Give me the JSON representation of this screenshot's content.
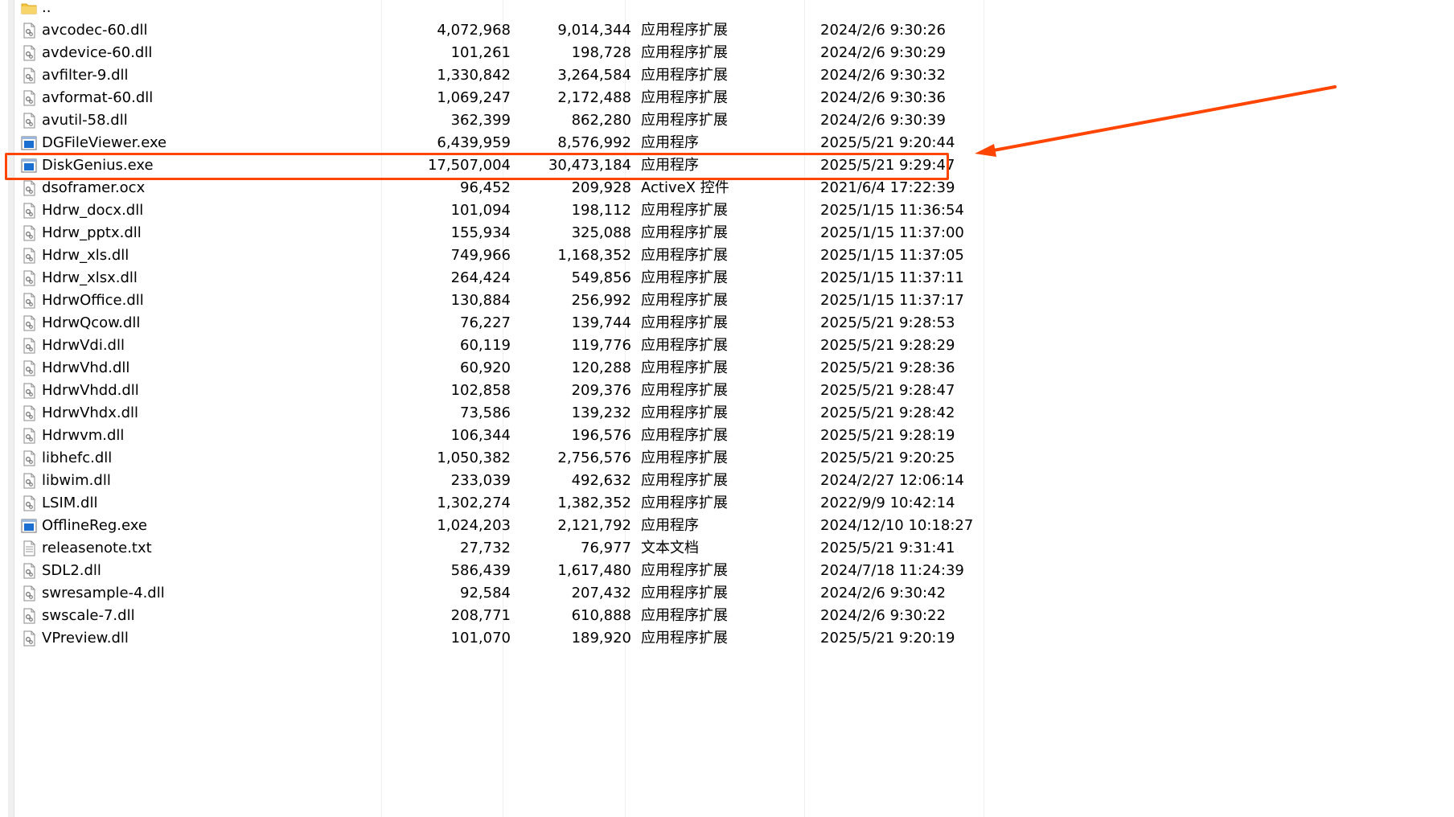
{
  "files": [
    {
      "icon": "folder-up-icon",
      "name": "..",
      "size": "",
      "packed": "",
      "type": "",
      "modified": ""
    },
    {
      "icon": "dll-file-icon",
      "name": "avcodec-60.dll",
      "size": "4,072,968",
      "packed": "9,014,344",
      "type": "应用程序扩展",
      "modified": "2024/2/6 9:30:26"
    },
    {
      "icon": "dll-file-icon",
      "name": "avdevice-60.dll",
      "size": "101,261",
      "packed": "198,728",
      "type": "应用程序扩展",
      "modified": "2024/2/6 9:30:29"
    },
    {
      "icon": "dll-file-icon",
      "name": "avfilter-9.dll",
      "size": "1,330,842",
      "packed": "3,264,584",
      "type": "应用程序扩展",
      "modified": "2024/2/6 9:30:32"
    },
    {
      "icon": "dll-file-icon",
      "name": "avformat-60.dll",
      "size": "1,069,247",
      "packed": "2,172,488",
      "type": "应用程序扩展",
      "modified": "2024/2/6 9:30:36"
    },
    {
      "icon": "dll-file-icon",
      "name": "avutil-58.dll",
      "size": "362,399",
      "packed": "862,280",
      "type": "应用程序扩展",
      "modified": "2024/2/6 9:30:39"
    },
    {
      "icon": "exe-file-icon",
      "name": "DGFileViewer.exe",
      "size": "6,439,959",
      "packed": "8,576,992",
      "type": "应用程序",
      "modified": "2025/5/21 9:20:44"
    },
    {
      "icon": "exe-file-icon",
      "name": "DiskGenius.exe",
      "size": "17,507,004",
      "packed": "30,473,184",
      "type": "应用程序",
      "modified": "2025/5/21 9:29:47"
    },
    {
      "icon": "dll-file-icon",
      "name": "dsoframer.ocx",
      "size": "96,452",
      "packed": "209,928",
      "type": "ActiveX 控件",
      "modified": "2021/6/4 17:22:39"
    },
    {
      "icon": "dll-file-icon",
      "name": "Hdrw_docx.dll",
      "size": "101,094",
      "packed": "198,112",
      "type": "应用程序扩展",
      "modified": "2025/1/15 11:36:54"
    },
    {
      "icon": "dll-file-icon",
      "name": "Hdrw_pptx.dll",
      "size": "155,934",
      "packed": "325,088",
      "type": "应用程序扩展",
      "modified": "2025/1/15 11:37:00"
    },
    {
      "icon": "dll-file-icon",
      "name": "Hdrw_xls.dll",
      "size": "749,966",
      "packed": "1,168,352",
      "type": "应用程序扩展",
      "modified": "2025/1/15 11:37:05"
    },
    {
      "icon": "dll-file-icon",
      "name": "Hdrw_xlsx.dll",
      "size": "264,424",
      "packed": "549,856",
      "type": "应用程序扩展",
      "modified": "2025/1/15 11:37:11"
    },
    {
      "icon": "dll-file-icon",
      "name": "HdrwOffice.dll",
      "size": "130,884",
      "packed": "256,992",
      "type": "应用程序扩展",
      "modified": "2025/1/15 11:37:17"
    },
    {
      "icon": "dll-file-icon",
      "name": "HdrwQcow.dll",
      "size": "76,227",
      "packed": "139,744",
      "type": "应用程序扩展",
      "modified": "2025/5/21 9:28:53"
    },
    {
      "icon": "dll-file-icon",
      "name": "HdrwVdi.dll",
      "size": "60,119",
      "packed": "119,776",
      "type": "应用程序扩展",
      "modified": "2025/5/21 9:28:29"
    },
    {
      "icon": "dll-file-icon",
      "name": "HdrwVhd.dll",
      "size": "60,920",
      "packed": "120,288",
      "type": "应用程序扩展",
      "modified": "2025/5/21 9:28:36"
    },
    {
      "icon": "dll-file-icon",
      "name": "HdrwVhdd.dll",
      "size": "102,858",
      "packed": "209,376",
      "type": "应用程序扩展",
      "modified": "2025/5/21 9:28:47"
    },
    {
      "icon": "dll-file-icon",
      "name": "HdrwVhdx.dll",
      "size": "73,586",
      "packed": "139,232",
      "type": "应用程序扩展",
      "modified": "2025/5/21 9:28:42"
    },
    {
      "icon": "dll-file-icon",
      "name": "Hdrwvm.dll",
      "size": "106,344",
      "packed": "196,576",
      "type": "应用程序扩展",
      "modified": "2025/5/21 9:28:19"
    },
    {
      "icon": "dll-file-icon",
      "name": "libhefc.dll",
      "size": "1,050,382",
      "packed": "2,756,576",
      "type": "应用程序扩展",
      "modified": "2025/5/21 9:20:25"
    },
    {
      "icon": "dll-file-icon",
      "name": "libwim.dll",
      "size": "233,039",
      "packed": "492,632",
      "type": "应用程序扩展",
      "modified": "2024/2/27 12:06:14"
    },
    {
      "icon": "dll-file-icon",
      "name": "LSIM.dll",
      "size": "1,302,274",
      "packed": "1,382,352",
      "type": "应用程序扩展",
      "modified": "2022/9/9 10:42:14"
    },
    {
      "icon": "exe-file-icon",
      "name": "OfflineReg.exe",
      "size": "1,024,203",
      "packed": "2,121,792",
      "type": "应用程序",
      "modified": "2024/12/10 10:18:27"
    },
    {
      "icon": "text-file-icon",
      "name": "releasenote.txt",
      "size": "27,732",
      "packed": "76,977",
      "type": "文本文档",
      "modified": "2025/5/21 9:31:41"
    },
    {
      "icon": "dll-file-icon",
      "name": "SDL2.dll",
      "size": "586,439",
      "packed": "1,617,480",
      "type": "应用程序扩展",
      "modified": "2024/7/18 11:24:39"
    },
    {
      "icon": "dll-file-icon",
      "name": "swresample-4.dll",
      "size": "92,584",
      "packed": "207,432",
      "type": "应用程序扩展",
      "modified": "2024/2/6 9:30:42"
    },
    {
      "icon": "dll-file-icon",
      "name": "swscale-7.dll",
      "size": "208,771",
      "packed": "610,888",
      "type": "应用程序扩展",
      "modified": "2024/2/6 9:30:22"
    },
    {
      "icon": "dll-file-icon",
      "name": "VPreview.dll",
      "size": "101,070",
      "packed": "189,920",
      "type": "应用程序扩展",
      "modified": "2025/5/21 9:20:19"
    }
  ],
  "annotation": {
    "highlighted_file": "DiskGenius.exe",
    "color": "#ff4500"
  },
  "colors": {
    "exe_icon_blue": "#1a6fd0",
    "folder_yellow": "#f5c542",
    "separator": "#f0f0f0"
  }
}
